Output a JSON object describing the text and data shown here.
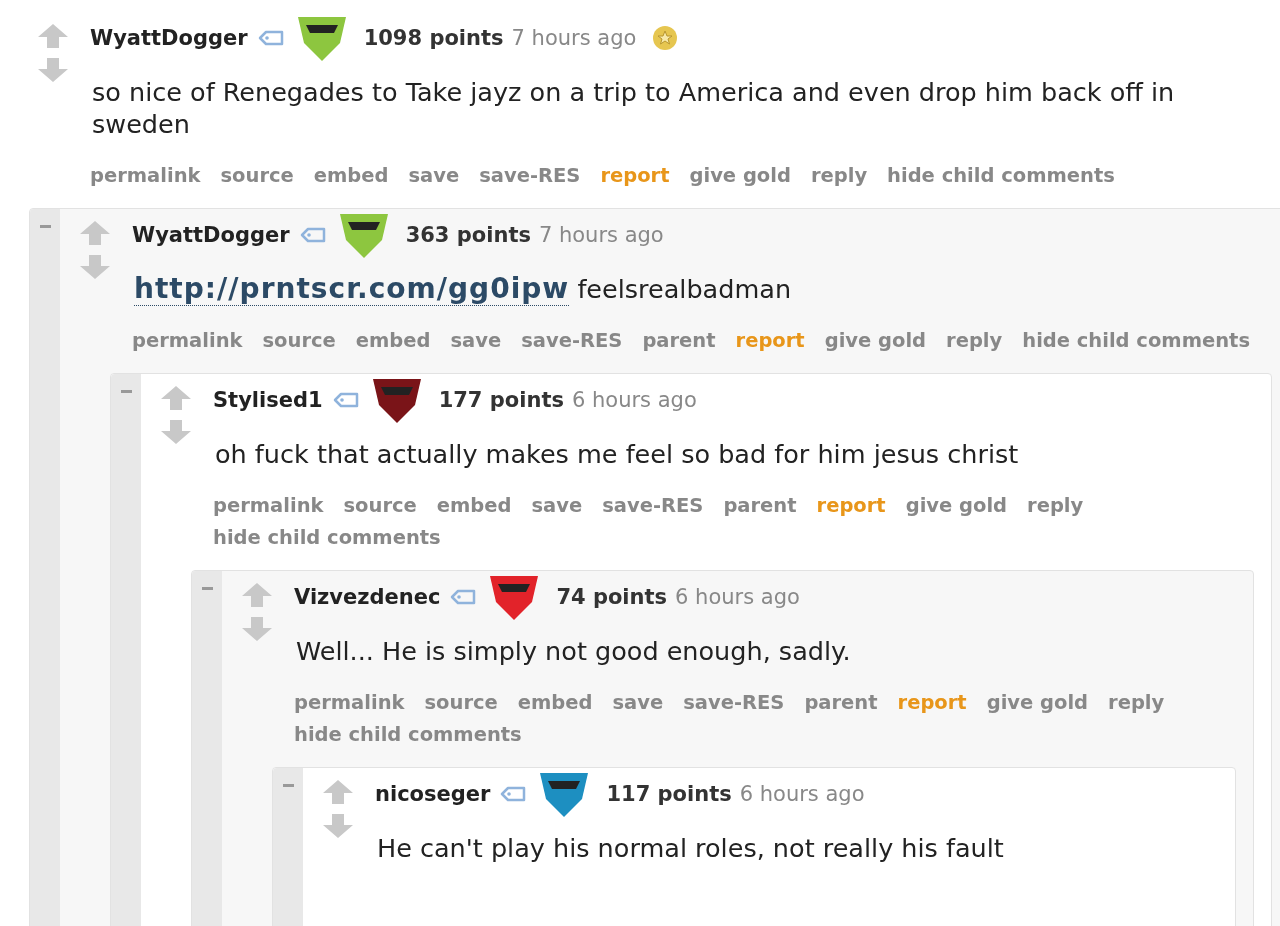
{
  "comment": {
    "author": "WyattDogger",
    "color": "#8dc63f",
    "score": "1098 points",
    "time": "7 hours ago",
    "gilded": true,
    "body": [
      {
        "kind": "text",
        "text": "so nice of Renegades to Take jayz on a trip to America and even drop him back off in sweden"
      }
    ],
    "buttons": [
      {
        "label": "permalink",
        "kind": "plain"
      },
      {
        "label": "source",
        "kind": "plain"
      },
      {
        "label": "embed",
        "kind": "plain"
      },
      {
        "label": "save",
        "kind": "plain"
      },
      {
        "label": "save-RES",
        "kind": "plain"
      },
      {
        "label": "report",
        "kind": "warning"
      },
      {
        "label": "give gold",
        "kind": "plain"
      },
      {
        "label": "reply",
        "kind": "plain"
      },
      {
        "label": "hide child comments",
        "kind": "plain"
      }
    ],
    "children": [
      {
        "author": "WyattDogger",
        "color": "#8dc63f",
        "score": "363 points",
        "time": "7 hours ago",
        "gilded": false,
        "body": [
          {
            "kind": "link",
            "text": "http://prntscr.com/gg0ipw"
          },
          {
            "kind": "text",
            "text": " feelsrealbadman"
          }
        ],
        "buttons": [
          {
            "label": "permalink",
            "kind": "plain"
          },
          {
            "label": "source",
            "kind": "plain"
          },
          {
            "label": "embed",
            "kind": "plain"
          },
          {
            "label": "save",
            "kind": "plain"
          },
          {
            "label": "save-RES",
            "kind": "plain"
          },
          {
            "label": "parent",
            "kind": "plain"
          },
          {
            "label": "report",
            "kind": "warning"
          },
          {
            "label": "give gold",
            "kind": "plain"
          },
          {
            "label": "reply",
            "kind": "plain"
          },
          {
            "label": "hide child comments",
            "kind": "plain"
          }
        ],
        "children": [
          {
            "author": "Stylised1",
            "color": "#7a1418",
            "score": "177 points",
            "time": "6 hours ago",
            "gilded": false,
            "body": [
              {
                "kind": "text",
                "text": "oh fuck that actually makes me feel so bad for him jesus christ"
              }
            ],
            "buttons": [
              {
                "label": "permalink",
                "kind": "plain"
              },
              {
                "label": "source",
                "kind": "plain"
              },
              {
                "label": "embed",
                "kind": "plain"
              },
              {
                "label": "save",
                "kind": "plain"
              },
              {
                "label": "save-RES",
                "kind": "plain"
              },
              {
                "label": "parent",
                "kind": "plain"
              },
              {
                "label": "report",
                "kind": "warning"
              },
              {
                "label": "give gold",
                "kind": "plain"
              },
              {
                "label": "reply",
                "kind": "plain"
              },
              {
                "label": "hide child comments",
                "kind": "plain"
              }
            ],
            "children": [
              {
                "author": "Vizvezdenec",
                "color": "#e2232a",
                "score": "74 points",
                "time": "6 hours ago",
                "gilded": false,
                "body": [
                  {
                    "kind": "text",
                    "text": "Well... He is simply not good enough, sadly."
                  }
                ],
                "buttons": [
                  {
                    "label": "permalink",
                    "kind": "plain"
                  },
                  {
                    "label": "source",
                    "kind": "plain"
                  },
                  {
                    "label": "embed",
                    "kind": "plain"
                  },
                  {
                    "label": "save",
                    "kind": "plain"
                  },
                  {
                    "label": "save-RES",
                    "kind": "plain"
                  },
                  {
                    "label": "parent",
                    "kind": "plain"
                  },
                  {
                    "label": "report",
                    "kind": "warning"
                  },
                  {
                    "label": "give gold",
                    "kind": "plain"
                  },
                  {
                    "label": "reply",
                    "kind": "plain"
                  },
                  {
                    "label": "hide child comments",
                    "kind": "plain"
                  }
                ],
                "children": [
                  {
                    "author": "nicoseger",
                    "color": "#1d8fc1",
                    "score": "117 points",
                    "time": "6 hours ago",
                    "gilded": false,
                    "body": [
                      {
                        "kind": "text",
                        "text": "He can't play his normal roles, not really his fault"
                      }
                    ]
                  }
                ]
              }
            ]
          }
        ]
      }
    ]
  }
}
